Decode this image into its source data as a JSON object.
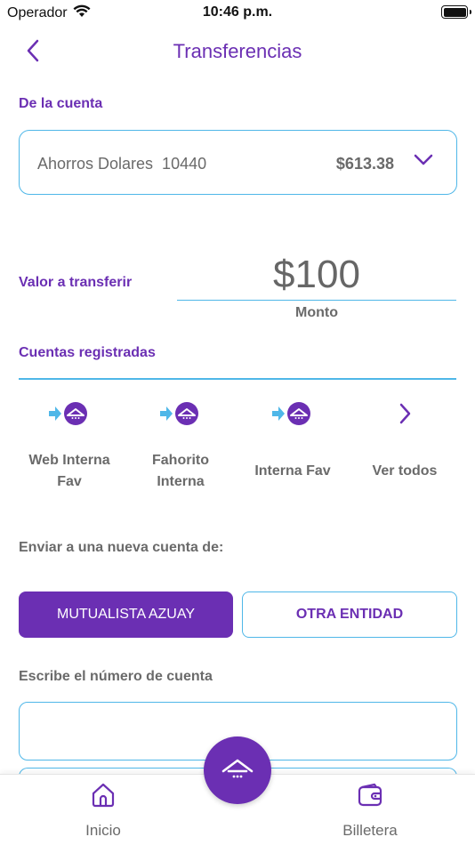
{
  "status_bar": {
    "carrier": "Operador",
    "time": "10:46 p.m."
  },
  "header": {
    "title": "Transferencias",
    "back_icon": "chevron-left-icon"
  },
  "from_account": {
    "label": "De la cuenta",
    "account_name": "Ahorros Dolares  10440",
    "balance": "$613.38"
  },
  "amount": {
    "label": "Valor a transferir",
    "value": "$100",
    "caption": "Monto"
  },
  "registered_accounts": {
    "label": "Cuentas registradas",
    "items": [
      {
        "label": "Web Interna Fav"
      },
      {
        "label": "Fahorito Interna"
      },
      {
        "label": "Interna Fav"
      }
    ],
    "see_all_label": "Ver todos"
  },
  "new_account": {
    "label": "Enviar a una nueva cuenta de:",
    "options": [
      {
        "label": "MUTUALISTA AZUAY",
        "selected": true
      },
      {
        "label": "OTRA ENTIDAD",
        "selected": false
      }
    ]
  },
  "account_number": {
    "label": "Escribe el número de cuenta",
    "value": ""
  },
  "tab_bar": {
    "home_label": "Inicio",
    "wallet_label": "Billetera"
  },
  "colors": {
    "brand_purple": "#6b2fb3",
    "accent_blue": "#4fb7e8",
    "text_gray": "#6a6a6a"
  }
}
